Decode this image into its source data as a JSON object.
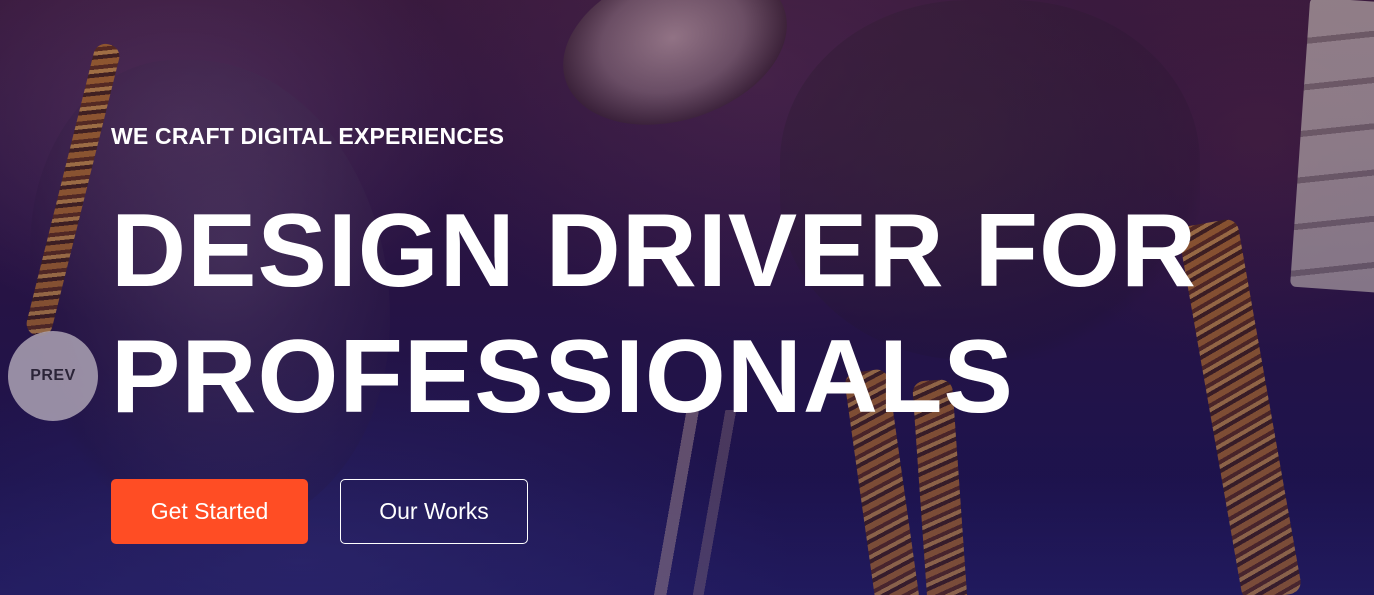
{
  "hero": {
    "eyebrow": "WE CRAFT DIGITAL EXPERIENCES",
    "headline_line1": "DESIGN DRIVER FOR",
    "headline_line2": "PROFESSIONALS",
    "primary_button": "Get Started",
    "secondary_button": "Our Works"
  },
  "slider": {
    "prev_label": "PREV"
  },
  "colors": {
    "accent": "#ff4d24",
    "text": "#ffffff",
    "overlay": "#2a1548"
  }
}
